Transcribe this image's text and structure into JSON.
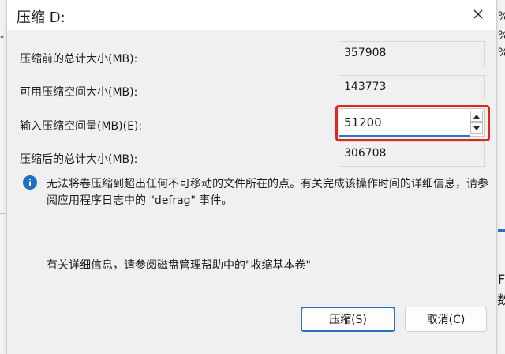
{
  "dialog": {
    "title": "压缩 D:",
    "close_icon": "close-icon"
  },
  "fields": {
    "total_before_label": "压缩前的总计大小(MB):",
    "total_before_value": "357908",
    "available_label": "可用压缩空间大小(MB):",
    "available_value": "143773",
    "input_label": "输入压缩空间量(MB)(E):",
    "input_value": "51200",
    "total_after_label": "压缩后的总计大小(MB):",
    "total_after_value": "306708"
  },
  "info": {
    "icon": "info-icon",
    "text": "无法将卷压缩到超出任何不可移动的文件所在的点。有关完成该操作时间的详细信息，请参阅应用程序日志中的 \"defrag\" 事件。",
    "help_text": "有关详细信息，请参阅磁盘管理帮助中的\"收缩基本卷\""
  },
  "buttons": {
    "shrink_label": "压缩(S)",
    "cancel_label": "取消(C)"
  },
  "background": {
    "frag_percent_1": "%",
    "frag_percent_2": "%",
    "frag_percent_3": "%",
    "frag_f": "F",
    "frag_number": "数"
  },
  "colors": {
    "highlight": "#e0271f",
    "accent": "#2b6fbf",
    "info_icon": "#1e6fc5"
  }
}
